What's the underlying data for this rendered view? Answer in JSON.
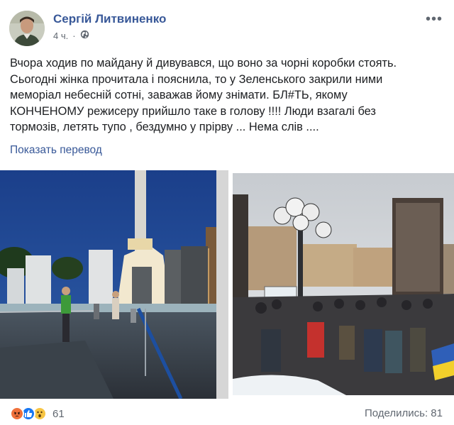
{
  "post": {
    "author": "Сергій Литвиненко",
    "time": "4 ч.",
    "privacy_icon": "globe-icon",
    "more_icon": "more-dots-icon",
    "text_lines": [
      "Вчора ходив по майдану й дивувався, що воно за чорні коробки стоять.",
      "Сьогодні жінка прочитала і пояснила, то у Зеленського закрили ними",
      "меморіал небесній сотні, заважав йому знімати. БЛ#ТЬ, якому",
      "КОНЧЕНОМУ режисеру прийшло таке в голову !!!! Люди взагалі без",
      "тормозів, летять тупо , бездумно у прірву ... Нема слів ...."
    ],
    "translate_link": "Показать перевод"
  },
  "footer": {
    "reaction_icons": [
      "angry-icon",
      "like-icon",
      "wow-icon"
    ],
    "reaction_count": "61",
    "shares": "Поделились: 81"
  },
  "colors": {
    "link": "#385898",
    "meta": "#606770",
    "text": "#1c1e21"
  }
}
